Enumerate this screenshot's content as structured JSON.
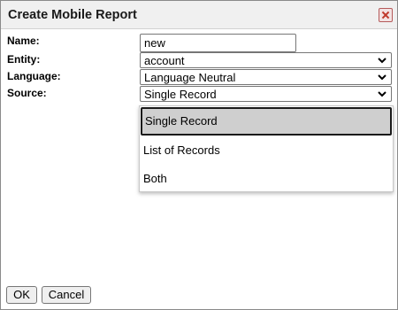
{
  "dialog": {
    "title": "Create Mobile Report",
    "close_icon": "close-icon"
  },
  "form": {
    "name_label": "Name:",
    "name_value": "new",
    "entity_label": "Entity:",
    "entity_value": "account",
    "language_label": "Language:",
    "language_value": "Language Neutral",
    "source_label": "Source:",
    "source_value": "Single Record"
  },
  "source_dropdown": {
    "options": [
      "Single Record",
      "List of Records",
      "Both"
    ],
    "highlighted": "Single Record"
  },
  "buttons": {
    "ok_label": "OK",
    "cancel_label": "Cancel"
  }
}
